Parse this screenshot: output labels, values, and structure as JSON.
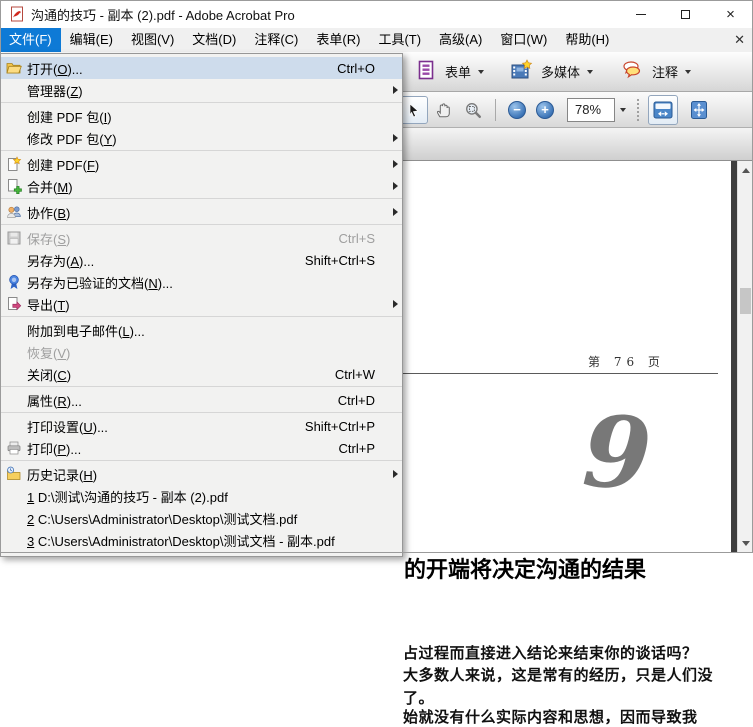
{
  "window": {
    "title": "沟通的技巧 - 副本 (2).pdf - Adobe Acrobat Pro"
  },
  "menubar": {
    "items": [
      {
        "label": "文件(F)",
        "active": true
      },
      {
        "label": "编辑(E)"
      },
      {
        "label": "视图(V)"
      },
      {
        "label": "文档(D)"
      },
      {
        "label": "注释(C)"
      },
      {
        "label": "表单(R)"
      },
      {
        "label": "工具(T)"
      },
      {
        "label": "高级(A)"
      },
      {
        "label": "窗口(W)"
      },
      {
        "label": "帮助(H)"
      }
    ]
  },
  "file_menu": {
    "items": [
      {
        "label": "打开(O)...",
        "shortcut": "Ctrl+O",
        "icon": "open-folder-icon",
        "highlighted": true
      },
      {
        "label": "管理器(Z)",
        "submenu": true
      },
      {
        "separator": true
      },
      {
        "label": "创建 PDF 包(I)"
      },
      {
        "label": "修改 PDF 包(Y)",
        "submenu": true
      },
      {
        "separator": true
      },
      {
        "label": "创建 PDF(F)",
        "icon": "create-pdf-icon",
        "submenu": true
      },
      {
        "label": "合并(M)",
        "icon": "combine-files-icon",
        "submenu": true
      },
      {
        "separator": true
      },
      {
        "label": "协作(B)",
        "icon": "collaborate-icon",
        "submenu": true
      },
      {
        "separator": true
      },
      {
        "label": "保存(S)",
        "shortcut": "Ctrl+S",
        "icon": "save-icon",
        "disabled": true
      },
      {
        "label": "另存为(A)...",
        "shortcut": "Shift+Ctrl+S"
      },
      {
        "label": "另存为已验证的文档(N)...",
        "icon": "certify-icon"
      },
      {
        "label": "导出(T)",
        "icon": "export-icon",
        "submenu": true
      },
      {
        "separator": true
      },
      {
        "label": "附加到电子邮件(L)..."
      },
      {
        "label": "恢复(V)",
        "disabled": true
      },
      {
        "label": "关闭(C)",
        "shortcut": "Ctrl+W"
      },
      {
        "separator": true
      },
      {
        "label": "属性(R)...",
        "shortcut": "Ctrl+D"
      },
      {
        "separator": true
      },
      {
        "label": "打印设置(U)...",
        "shortcut": "Shift+Ctrl+P"
      },
      {
        "label": "打印(P)...",
        "shortcut": "Ctrl+P",
        "icon": "print-icon"
      },
      {
        "separator": true
      },
      {
        "label": "历史记录(H)",
        "icon": "history-icon",
        "submenu": true
      },
      {
        "label": "1 D:\\测试\\沟通的技巧 - 副本 (2).pdf",
        "recent": true
      },
      {
        "label": "2 C:\\Users\\Administrator\\Desktop\\测试文档.pdf",
        "recent": true
      },
      {
        "label": "3 C:\\Users\\Administrator\\Desktop\\测试文档 - 副本.pdf",
        "recent": true
      }
    ]
  },
  "task_toolbar": {
    "buttons": [
      {
        "label": "表单",
        "icon": "form-icon"
      },
      {
        "label": "多媒体",
        "icon": "multimedia-icon"
      },
      {
        "label": "注释",
        "icon": "comment-icon"
      }
    ]
  },
  "view_toolbar": {
    "zoom_level": "78%"
  },
  "document": {
    "page_header": "第 76 页",
    "chapter_number": "9",
    "headline": "的开端将决定沟通的结果",
    "body_lines": [
      "占过程而直接进入结论来结束你的谈话吗？",
      "大多数人来说，这是常有的经历，只是人们没",
      "了。",
      "始就没有什么实际内容和思想，因而导致我"
    ]
  }
}
